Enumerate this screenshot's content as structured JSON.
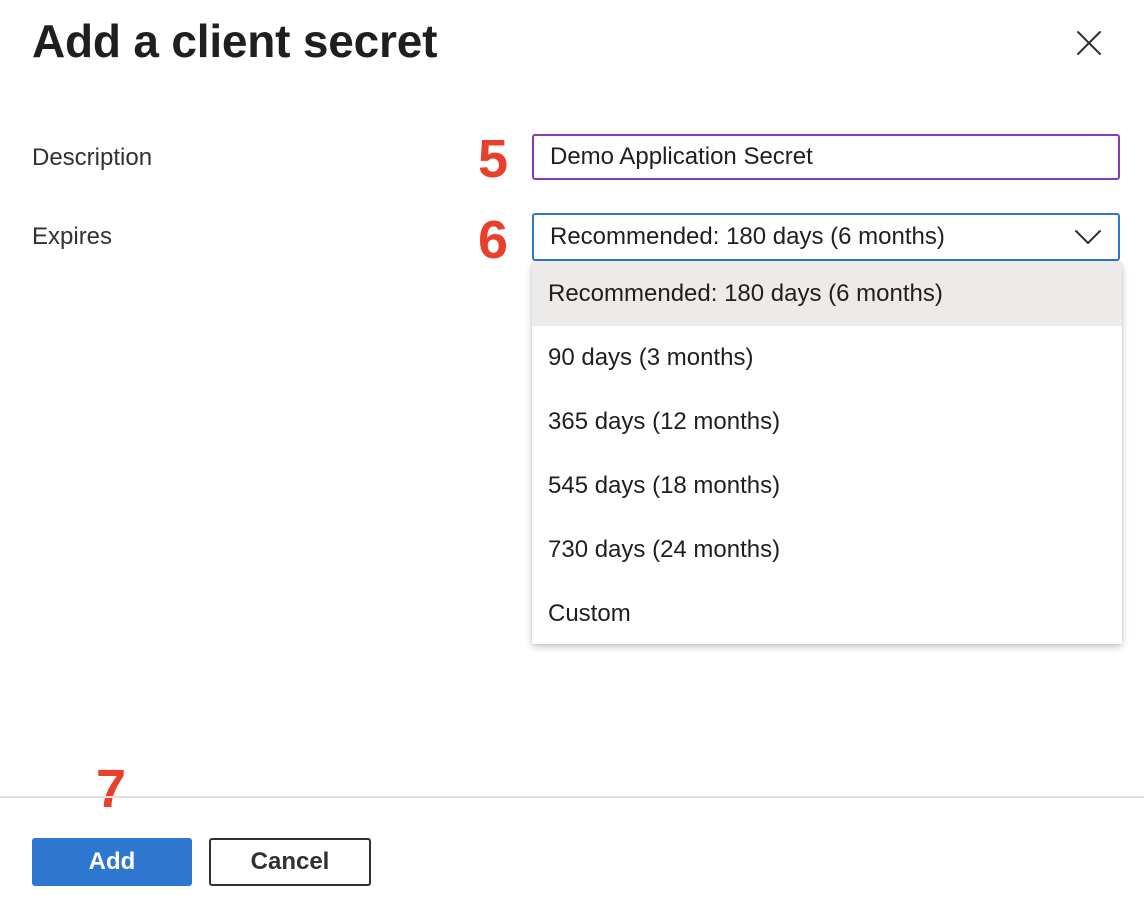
{
  "panel": {
    "title": "Add a client secret"
  },
  "form": {
    "description": {
      "label": "Description",
      "value": "Demo Application Secret"
    },
    "expires": {
      "label": "Expires",
      "selected": "Recommended: 180 days (6 months)",
      "options": [
        "Recommended: 180 days (6 months)",
        "90 days (3 months)",
        "365 days (12 months)",
        "545 days (18 months)",
        "730 days (24 months)",
        "Custom"
      ]
    }
  },
  "annotations": {
    "step_description": "5",
    "step_expires": "6",
    "step_add": "7",
    "color": "#e8402c"
  },
  "footer": {
    "add_label": "Add",
    "cancel_label": "Cancel"
  },
  "icons": {
    "close": "close-icon",
    "chevron": "chevron-down-icon"
  },
  "colors": {
    "primary": "#2e77d0",
    "input_border": "#8a3ab9",
    "selected_option_bg": "#edebe9"
  }
}
